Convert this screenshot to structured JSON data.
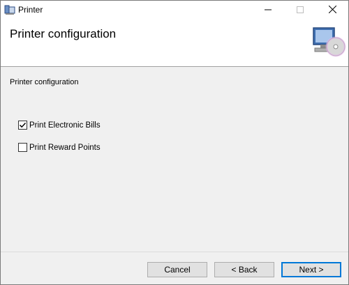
{
  "window": {
    "title": "Printer",
    "controls": {
      "minimize": "minimize-icon",
      "maximize": "maximize-icon",
      "close": "close-icon"
    }
  },
  "header": {
    "title": "Printer configuration",
    "icon": "computer-cd-icon"
  },
  "body": {
    "section_label": "Printer configuration",
    "options": [
      {
        "label": "Print Electronic Bills",
        "checked": true
      },
      {
        "label": "Print Reward Points",
        "checked": false
      }
    ]
  },
  "footer": {
    "cancel_label": "Cancel",
    "back_label": "< Back",
    "next_label": "Next >"
  },
  "colors": {
    "accent": "#0078d7",
    "button_bg": "#e1e1e1",
    "window_bg": "#f0f0f0"
  }
}
